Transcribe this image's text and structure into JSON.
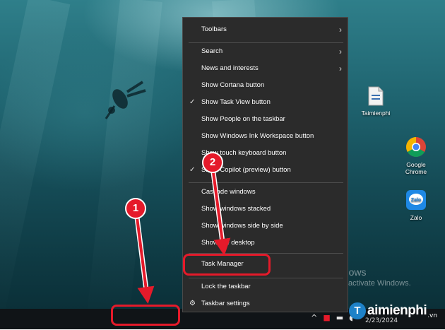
{
  "context_menu": {
    "items": [
      {
        "label": "Toolbars",
        "submenu": true,
        "checked": false
      },
      {
        "label": "Search",
        "submenu": true,
        "checked": false
      },
      {
        "label": "News and interests",
        "submenu": true,
        "checked": false
      },
      {
        "label": "Show Cortana button",
        "submenu": false,
        "checked": false
      },
      {
        "label": "Show Task View button",
        "submenu": false,
        "checked": true
      },
      {
        "label": "Show People on the taskbar",
        "submenu": false,
        "checked": false
      },
      {
        "label": "Show Windows Ink Workspace button",
        "submenu": false,
        "checked": false
      },
      {
        "label": "Show touch keyboard button",
        "submenu": false,
        "checked": false
      },
      {
        "label": "Show Copilot (preview) button",
        "submenu": false,
        "checked": true
      },
      {
        "label": "Cascade windows",
        "submenu": false,
        "checked": false
      },
      {
        "label": "Show windows stacked",
        "submenu": false,
        "checked": false
      },
      {
        "label": "Show windows side by side",
        "submenu": false,
        "checked": false
      },
      {
        "label": "Show the desktop",
        "submenu": false,
        "checked": false
      },
      {
        "label": "Task Manager",
        "submenu": false,
        "checked": false,
        "highlighted": true
      },
      {
        "label": "Lock the taskbar",
        "submenu": false,
        "checked": false
      },
      {
        "label": "Taskbar settings",
        "submenu": false,
        "checked": false,
        "icon": "gear-icon"
      }
    ]
  },
  "desktop_icons": [
    {
      "label": "Taimienphi",
      "icon": "document-icon"
    },
    {
      "label": "Google Chrome",
      "icon": "chrome-icon"
    },
    {
      "label": "Zalo",
      "icon": "zalo-icon"
    }
  ],
  "watermark": {
    "title": "Activate Windows",
    "subtitle": "Go to Settings to activate Windows."
  },
  "taskbar": {
    "date": "2/23/2024"
  },
  "annotations": {
    "step1": "1",
    "step2": "2"
  },
  "logo": {
    "mark": "T",
    "text": "aimienphi",
    "suffix": ".vn"
  },
  "colors": {
    "menu_bg": "#2b2b2b",
    "highlight_red": "#e51a2a",
    "taskbar_bg": "#101417"
  }
}
